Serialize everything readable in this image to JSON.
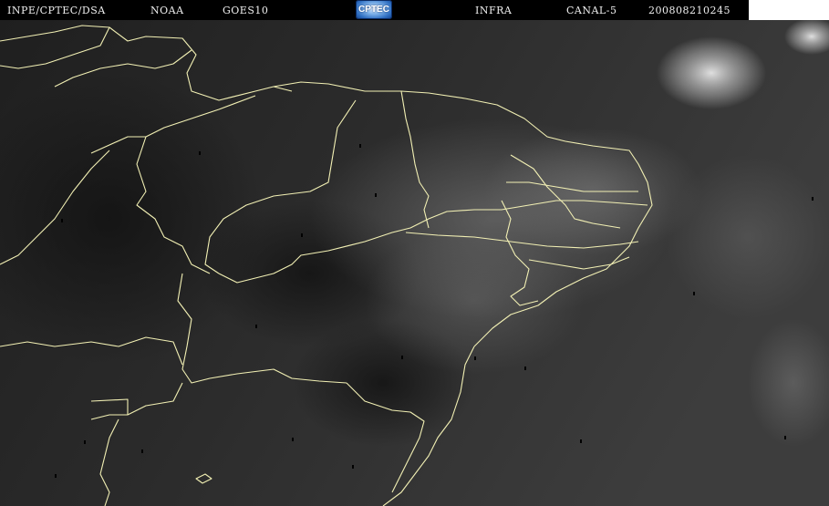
{
  "header": {
    "source": "INPE/CPTEC/DSA",
    "agency": "NOAA",
    "satellite": "GOES10",
    "logo_text": "CPTEC",
    "band": "INFRA",
    "channel": "CANAL-5",
    "timestamp": "200808210245"
  },
  "colors": {
    "header_background": "#000000",
    "header_text": "#f0f0f0",
    "border_lines": "#f2f0b4",
    "sea_background": "#363636"
  },
  "map": {
    "type": "satellite infrared image with state borders",
    "clouds": [
      "top-right cloud cluster",
      "central moisture band",
      "coastal cloud band"
    ]
  }
}
